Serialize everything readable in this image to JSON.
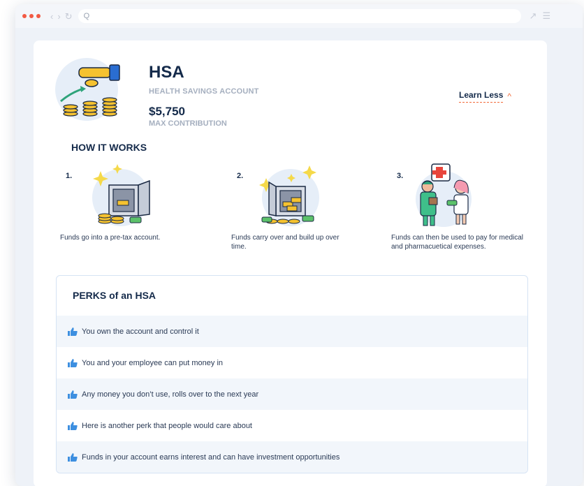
{
  "browser": {
    "search_glyph": "Q"
  },
  "hsa": {
    "title": "HSA",
    "subtitle": "HEALTH SAVINGS ACCOUNT",
    "amount": "$5,750",
    "amount_label": "MAX CONTRIBUTION"
  },
  "learn_less": {
    "label": "Learn Less",
    "chevron": "^"
  },
  "how_it_works": {
    "title": "HOW IT WORKS",
    "steps": [
      {
        "number": "1.",
        "text": "Funds go into a pre-tax account."
      },
      {
        "number": "2.",
        "text": "Funds carry over and build up over time."
      },
      {
        "number": "3.",
        "text": "Funds can then be used to pay for medical and pharmacuetical expenses."
      }
    ]
  },
  "perks": {
    "title": "PERKS of an HSA",
    "items": [
      "You own the account and control it",
      "You and your employee can put money in",
      "Any money you don’t use, rolls over to the next year",
      "Here is another perk that people would care about",
      "Funds in your account earns interest and can have investment opportunities"
    ]
  },
  "colors": {
    "accent": "#f26b3a",
    "navy": "#142a4a",
    "muted": "#a5afbf",
    "thumb": "#3d8fe0",
    "perk_alt_bg": "#f2f6fb"
  }
}
